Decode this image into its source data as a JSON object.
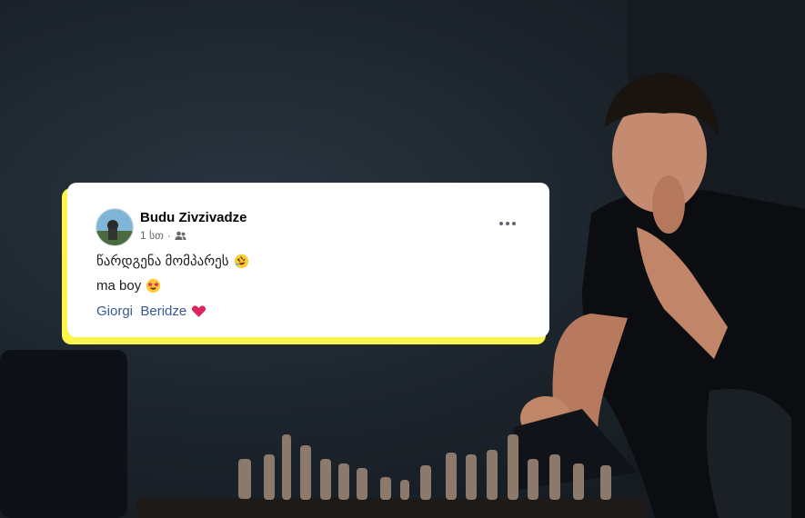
{
  "post": {
    "author": "Budu Zivzivadze",
    "time": "1 სთ",
    "separator": "·",
    "privacy_icon": "friends-icon",
    "more_icon": "more-options-icon",
    "comment1": "წარდგენა მომპარეს",
    "comment1_emoji": "rolling-laughing-emoji",
    "comment2": "ma boy",
    "comment2_emoji": "star-struck-emoji",
    "mention_first": "Giorgi",
    "mention_last": "Beridze",
    "comment3_emoji": "red-heart-emoji"
  },
  "colors": {
    "highlight": "#fbf44a",
    "mention": "#385898",
    "heart": "#e0245e"
  }
}
